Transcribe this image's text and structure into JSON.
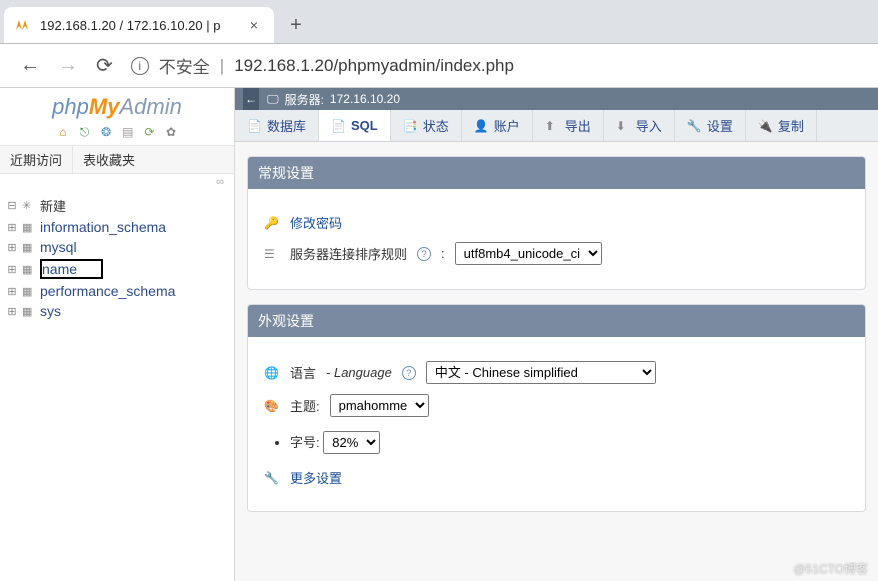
{
  "browser": {
    "tab_title": "192.168.1.20 / 172.16.10.20 | p",
    "url_insecure_label": "不安全",
    "url": "192.168.1.20/phpmyadmin/index.php"
  },
  "logo": {
    "part1": "php",
    "part2": "My",
    "part3": "Admin"
  },
  "sidebar": {
    "tabs": [
      "近期访问",
      "表收藏夹"
    ],
    "new_label": "新建",
    "databases": [
      "information_schema",
      "mysql",
      "name",
      "performance_schema",
      "sys"
    ],
    "highlighted_index": 2
  },
  "server_bar": {
    "label": "服务器:",
    "value": "172.16.10.20"
  },
  "tabs": [
    {
      "icon": "📄",
      "label": "数据库"
    },
    {
      "icon": "📄",
      "label": "SQL"
    },
    {
      "icon": "📑",
      "label": "状态"
    },
    {
      "icon": "👤",
      "label": "账户"
    },
    {
      "icon": "⬆",
      "label": "导出"
    },
    {
      "icon": "⬇",
      "label": "导入"
    },
    {
      "icon": "🔧",
      "label": "设置"
    },
    {
      "icon": "🔌",
      "label": "复制"
    }
  ],
  "panels": {
    "general": {
      "title": "常规设置",
      "change_password": "修改密码",
      "collation_label": "服务器连接排序规则",
      "collation_value": "utf8mb4_unicode_ci"
    },
    "appearance": {
      "title": "外观设置",
      "language_label": "语言",
      "language_label_en": "Language",
      "language_value": "中文 - Chinese simplified",
      "theme_label": "主题:",
      "theme_value": "pmahomme",
      "fontsize_label": "字号:",
      "fontsize_value": "82%",
      "more_settings": "更多设置"
    }
  },
  "watermark": "@51CTO博客"
}
